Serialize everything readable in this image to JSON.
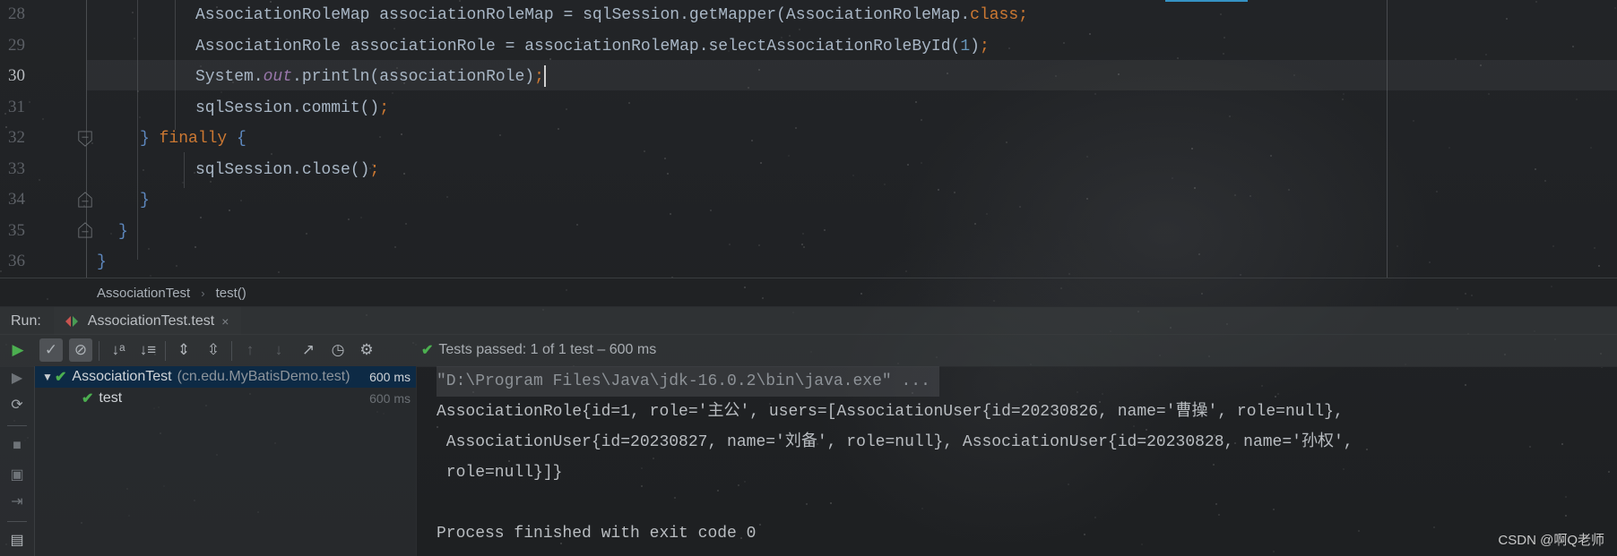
{
  "editor": {
    "lines": [
      {
        "number": "28",
        "indent": 2,
        "segments": [
          {
            "t": "AssociationRoleMap associationRoleMap = sqlSession.getMapper(AssociationRoleMap.",
            "c": ""
          },
          {
            "t": "class",
            "c": "kw"
          },
          {
            "t": ";",
            "c": "punct"
          }
        ]
      },
      {
        "number": "29",
        "indent": 2,
        "segments": [
          {
            "t": "AssociationRole associationRole = associationRoleMap.selectAssociationRoleById(",
            "c": ""
          },
          {
            "t": "1",
            "c": "num"
          },
          {
            "t": ")",
            "c": ""
          },
          {
            "t": ";",
            "c": "punct"
          }
        ]
      },
      {
        "number": "30",
        "indent": 2,
        "current": true,
        "segments": [
          {
            "t": "System.",
            "c": ""
          },
          {
            "t": "out",
            "c": "static"
          },
          {
            "t": ".println(associationRole)",
            "c": ""
          },
          {
            "t": ";",
            "c": "punct"
          }
        ]
      },
      {
        "number": "31",
        "indent": 2,
        "segments": [
          {
            "t": "sqlSession.commit()",
            "c": ""
          },
          {
            "t": ";",
            "c": "punct"
          }
        ]
      },
      {
        "number": "32",
        "indent": 1,
        "segments": [
          {
            "t": "} ",
            "c": "brace"
          },
          {
            "t": "finally",
            "c": "kw"
          },
          {
            "t": " {",
            "c": "brace"
          }
        ]
      },
      {
        "number": "33",
        "indent": 2,
        "segments": [
          {
            "t": "sqlSession.close()",
            "c": ""
          },
          {
            "t": ";",
            "c": "punct"
          }
        ]
      },
      {
        "number": "34",
        "indent": 1,
        "segments": [
          {
            "t": "}",
            "c": "brace"
          }
        ]
      },
      {
        "number": "35",
        "indent": 0.5,
        "segments": [
          {
            "t": "}",
            "c": "brace"
          }
        ]
      },
      {
        "number": "36",
        "indent": 0,
        "segments": [
          {
            "t": "}",
            "c": "brace"
          }
        ]
      }
    ]
  },
  "breadcrumb": {
    "items": [
      "AssociationTest",
      "test()"
    ],
    "separator": "›"
  },
  "run_panel": {
    "label": "Run:",
    "tab": {
      "title": "AssociationTest.test",
      "close_icon": "×"
    },
    "status": {
      "icon": "check-icon",
      "text": "Tests passed: 1 of 1 test – 600 ms"
    },
    "toolbar": [
      {
        "name": "rerun-button",
        "glyph": "▶"
      },
      {
        "name": "show-passed-toggle",
        "glyph": "✓"
      },
      {
        "name": "show-ignored-toggle",
        "glyph": "⊘"
      },
      {
        "name": "sort-alphabetically-button",
        "glyph": "↓ᵃ"
      },
      {
        "name": "sort-by-duration-button",
        "glyph": "↓≡"
      },
      {
        "name": "expand-all-button",
        "glyph": "⇕"
      },
      {
        "name": "collapse-all-button",
        "glyph": "⇳"
      },
      {
        "name": "previous-failed-button",
        "glyph": "↑"
      },
      {
        "name": "next-failed-button",
        "glyph": "↓"
      },
      {
        "name": "export-results-button",
        "glyph": "↗"
      },
      {
        "name": "test-history-button",
        "glyph": "◷"
      },
      {
        "name": "settings-button",
        "glyph": "⚙"
      }
    ],
    "side_strip": [
      {
        "name": "rerun-failed-icon",
        "glyph": "▶"
      },
      {
        "name": "toggle-auto-test-icon",
        "glyph": "⟳"
      },
      {
        "name": "stop-icon",
        "glyph": "■"
      },
      {
        "name": "dump-threads-icon",
        "glyph": "▣"
      },
      {
        "name": "exit-icon",
        "glyph": "⇥"
      },
      {
        "name": "layout-icon",
        "glyph": "▤"
      }
    ],
    "tree": [
      {
        "name": "AssociationTest",
        "package": "(cn.edu.MyBatisDemo.test)",
        "time": "600 ms",
        "expanded": true,
        "selected": true
      },
      {
        "name": "test",
        "time": "600 ms"
      }
    ],
    "console": [
      {
        "text": "\"D:\\Program Files\\Java\\jdk-16.0.2\\bin\\java.exe\" ...",
        "type": "command"
      },
      {
        "text": "AssociationRole{id=1, role='主公', users=[AssociationUser{id=20230826, name='曹操', role=null},",
        "type": "output"
      },
      {
        "text": " AssociationUser{id=20230827, name='刘备', role=null}, AssociationUser{id=20230828, name='孙权',",
        "type": "output"
      },
      {
        "text": " role=null}]}",
        "type": "output"
      },
      {
        "text": "",
        "type": "output"
      },
      {
        "text": "Process finished with exit code 0",
        "type": "output"
      }
    ]
  },
  "watermark": "CSDN @啊Q老师",
  "colors": {
    "keyword": "#cc7832",
    "number": "#6897bb",
    "static_field": "#9876aa",
    "success": "#4caf50",
    "selection": "#0d2a45"
  }
}
